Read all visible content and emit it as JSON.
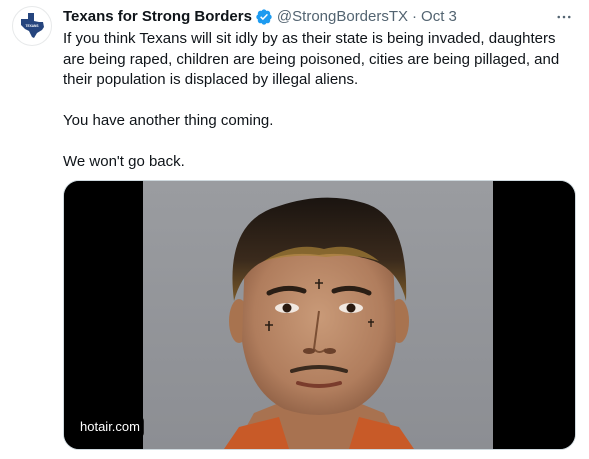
{
  "account": {
    "display_name": "Texans for Strong Borders",
    "handle": "@StrongBordersTX",
    "separator": "·",
    "date": "Oct 3",
    "verified": true,
    "avatar_icon": "texas-map-logo-icon"
  },
  "tweet": {
    "paragraphs": [
      "If you think Texans will sit idly by as their state is being invaded, daughters are being raped, children are being poisoned, cities are being pillaged, and their population is displaced by illegal aliens.",
      "You have another thing coming.",
      "We won't go back."
    ]
  },
  "media": {
    "source_label": "hotair.com",
    "type": "photo"
  },
  "icons": {
    "more": "more-horizontal-icon",
    "verified": "verified-badge-icon"
  },
  "colors": {
    "text": "#0f1419",
    "muted": "#536471",
    "verified": "#1d9bf0",
    "border": "#cfd9de"
  }
}
